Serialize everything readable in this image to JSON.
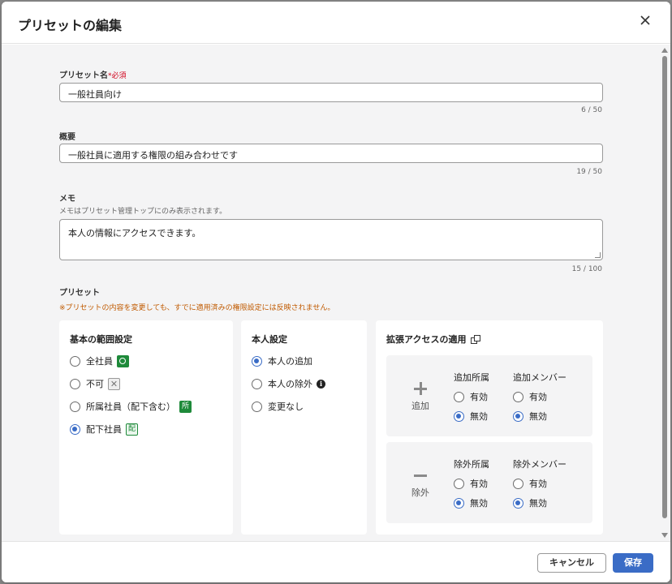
{
  "dialog": {
    "title": "プリセットの編集"
  },
  "name_field": {
    "label": "プリセット名",
    "required_mark": "*必須",
    "value": "一般社員向け",
    "counter": "6 / 50"
  },
  "summary_field": {
    "label": "概要",
    "value": "一般社員に適用する権限の組み合わせです",
    "counter": "19 / 50"
  },
  "memo_field": {
    "label": "メモ",
    "hint": "メモはプリセット管理トップにのみ表示されます。",
    "value": "本人の情報にアクセスできます。",
    "counter": "15 / 100"
  },
  "preset": {
    "label": "プリセット",
    "warning": "※プリセットの内容を変更しても、すでに適用済みの権限設定には反映されません。"
  },
  "scope": {
    "title": "基本の範囲設定",
    "options": [
      {
        "label": "全社員",
        "badge": "all",
        "selected": false
      },
      {
        "label": "不可",
        "badge": "none",
        "selected": false
      },
      {
        "label": "所属社員（配下含む）",
        "badge": "所",
        "selected": false
      },
      {
        "label": "配下社員",
        "badge": "配",
        "selected": true
      }
    ]
  },
  "self": {
    "title": "本人設定",
    "options": [
      {
        "label": "本人の追加",
        "selected": true
      },
      {
        "label": "本人の除外",
        "selected": false,
        "info": "i"
      },
      {
        "label": "変更なし",
        "selected": false
      }
    ]
  },
  "extended": {
    "title": "拡張アクセスの適用",
    "add": {
      "label": "追加",
      "dept_title": "追加所属",
      "member_title": "追加メンバー",
      "dept_options": [
        {
          "label": "有効",
          "selected": false
        },
        {
          "label": "無効",
          "selected": true
        }
      ],
      "member_options": [
        {
          "label": "有効",
          "selected": false
        },
        {
          "label": "無効",
          "selected": true
        }
      ]
    },
    "remove": {
      "label": "除外",
      "dept_title": "除外所属",
      "member_title": "除外メンバー",
      "dept_options": [
        {
          "label": "有効",
          "selected": false
        },
        {
          "label": "無効",
          "selected": true
        }
      ],
      "member_options": [
        {
          "label": "有効",
          "selected": false
        },
        {
          "label": "無効",
          "selected": true
        }
      ]
    }
  },
  "footer": {
    "cancel_label": "キャンセル",
    "save_label": "保存"
  },
  "colors": {
    "primary": "#3a6cc6",
    "badge_green": "#1e8a3a",
    "warning": "#c05a00",
    "required": "#d0021b"
  }
}
